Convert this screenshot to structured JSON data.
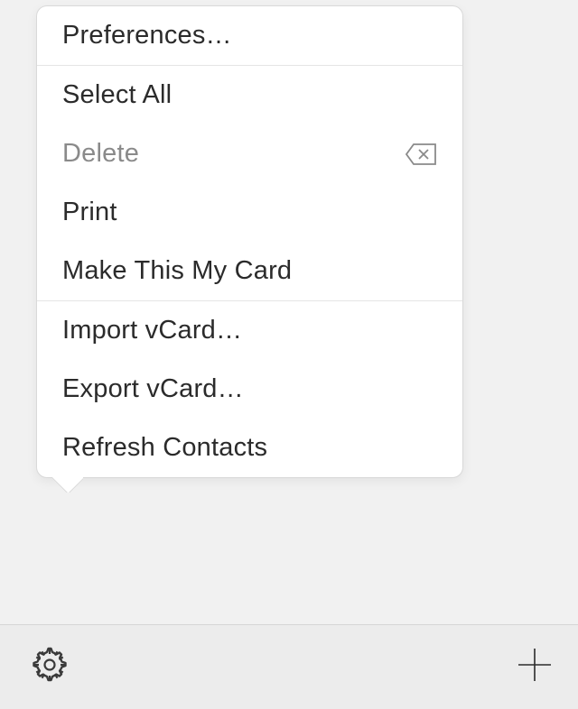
{
  "menu": {
    "groups": [
      [
        {
          "label": "Preferences…",
          "disabled": false,
          "delete_icon": false
        }
      ],
      [
        {
          "label": "Select All",
          "disabled": false,
          "delete_icon": false
        },
        {
          "label": "Delete",
          "disabled": true,
          "delete_icon": true
        },
        {
          "label": "Print",
          "disabled": false,
          "delete_icon": false
        },
        {
          "label": "Make This My Card",
          "disabled": false,
          "delete_icon": false
        }
      ],
      [
        {
          "label": "Import vCard…",
          "disabled": false,
          "delete_icon": false
        },
        {
          "label": "Export vCard…",
          "disabled": false,
          "delete_icon": false
        },
        {
          "label": "Refresh Contacts",
          "disabled": false,
          "delete_icon": false
        }
      ]
    ]
  },
  "toolbar": {
    "settings_tooltip": "Settings",
    "add_tooltip": "Add"
  }
}
